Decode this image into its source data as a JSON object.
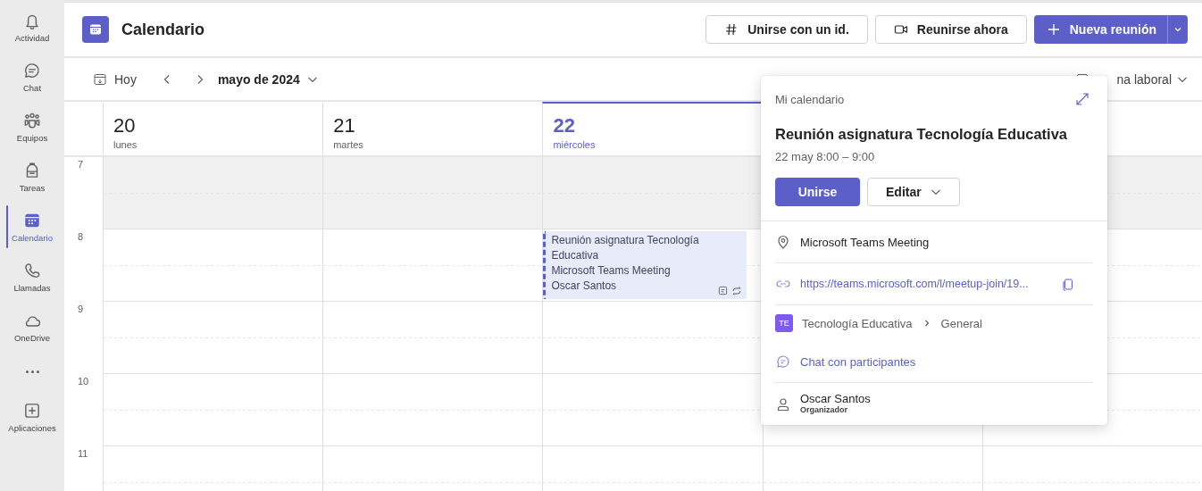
{
  "sidebar": {
    "items": [
      {
        "label": "Actividad",
        "selected": false
      },
      {
        "label": "Chat",
        "selected": false
      },
      {
        "label": "Equipos",
        "selected": false
      },
      {
        "label": "Tareas",
        "selected": false
      },
      {
        "label": "Calendario",
        "selected": true
      },
      {
        "label": "Llamadas",
        "selected": false
      },
      {
        "label": "OneDrive",
        "selected": false
      },
      {
        "kind": "more"
      },
      {
        "label": "Aplicaciones",
        "selected": false
      }
    ]
  },
  "header": {
    "title": "Calendario",
    "buttons": [
      {
        "label": "Unirse con un id.",
        "kind": "hash"
      },
      {
        "label": "Reunirse ahora",
        "kind": "video"
      },
      {
        "label": "Nueva reunión",
        "kind": "primary"
      }
    ]
  },
  "toolbar": {
    "today": "Hoy",
    "month": "mayo de 2024",
    "view": "na laboral"
  },
  "days": [
    {
      "number": "20",
      "weekday": "lunes",
      "selected": false
    },
    {
      "number": "21",
      "weekday": "martes",
      "selected": false
    },
    {
      "number": "22",
      "weekday": "miércoles",
      "selected": true,
      "events": [
        {
          "title": "Reunión asignatura Tecnología Educativa",
          "location": "Microsoft Teams Meeting",
          "organizer": "Oscar Santos"
        }
      ]
    }
  ],
  "hours": [
    {
      "label": "7",
      "working": false
    },
    {
      "label": "8",
      "working": true
    },
    {
      "label": "9",
      "working": true
    },
    {
      "label": "10",
      "working": true
    },
    {
      "label": "11",
      "working": true
    }
  ],
  "popover": {
    "calendar": "Mi calendario",
    "title": "Reunión asignatura Tecnología Educativa",
    "time": "22 may 8:00 – 9:00",
    "join": "Unirse",
    "edit": "Editar",
    "location": "Microsoft Teams Meeting",
    "link": "https://teams.microsoft.com/l/meetup-join/19...",
    "team_badge": "TE",
    "team": "Tecnología Educativa",
    "channel": "General",
    "chat": "Chat con participantes",
    "organizer": "Oscar Santos",
    "organizer_role": "Organizador"
  }
}
